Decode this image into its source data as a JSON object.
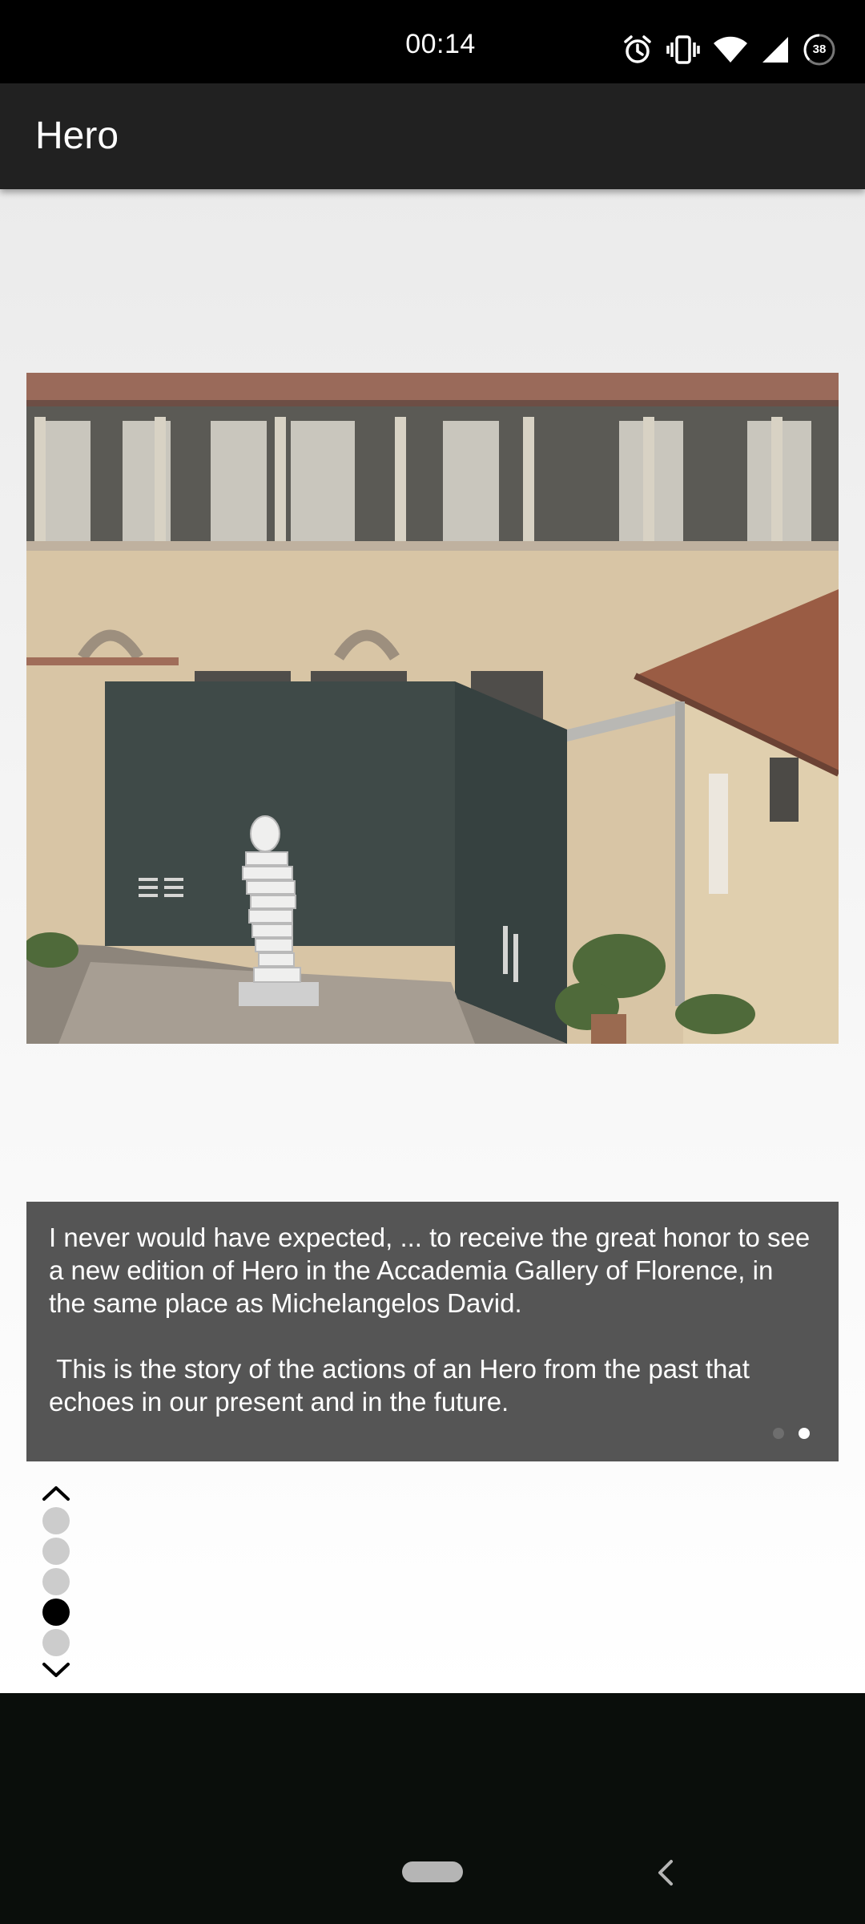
{
  "status_bar": {
    "time": "00:14",
    "battery": "38",
    "icons": [
      "alarm-icon",
      "vibrate-icon",
      "wifi-icon",
      "signal-icon",
      "battery-icon"
    ]
  },
  "app_bar": {
    "title": "Hero"
  },
  "photo": {
    "icon": "statue-courtyard-image"
  },
  "caption": {
    "paragraph_1": "I never would have expected, ... to receive the great honor to see a new edition of Hero in the Accademia Gallery of Florence, in the same place as Michelangelos David.",
    "paragraph_2": " This is the story of the actions of an Hero from the past that echoes in our present and in the future.",
    "pages": 2,
    "current_page": 2
  },
  "section_nav": {
    "count": 5,
    "current": 4,
    "up_icon": "chevron-up-icon",
    "down_icon": "chevron-down-icon"
  },
  "audio": {
    "icon": "speaker-icon"
  },
  "system_nav": {
    "home_icon": "home-pill-icon",
    "back_icon": "back-chevron-icon"
  },
  "colors": {
    "status_bar": "#000000",
    "app_bar": "#212121",
    "caption_card": "#555555",
    "nav_dot_active": "#000000",
    "nav_dot_inactive": "#cccccc",
    "system_nav": "#0a0e0b"
  }
}
